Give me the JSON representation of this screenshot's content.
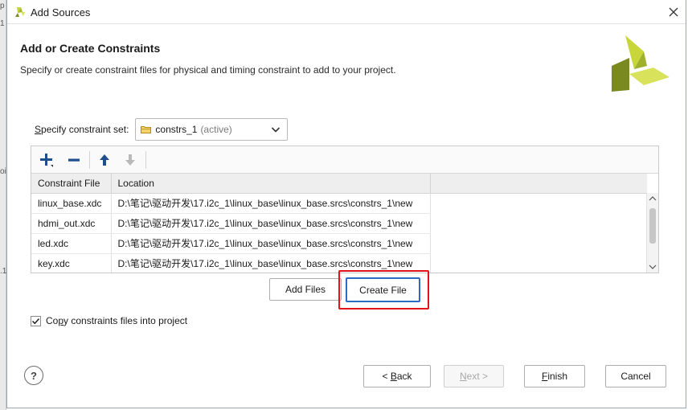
{
  "left_strip": {
    "fragments": [
      "p",
      "1",
      "oi",
      ".1"
    ]
  },
  "window": {
    "title": "Add Sources",
    "close_icon": "close-icon"
  },
  "header": {
    "title": "Add or Create Constraints",
    "subtitle": "Specify or create constraint files for physical and timing constraint to add to your project."
  },
  "constraint_set": {
    "label_prefix": "S",
    "label_rest": "pecify constraint set:",
    "value": "constrs_1",
    "status": "(active)"
  },
  "toolbar": {
    "add_icon": "plus-icon",
    "remove_icon": "minus-icon",
    "up_icon": "arrow-up-icon",
    "down_icon": "arrow-down-icon"
  },
  "table": {
    "headers": [
      "Constraint File",
      "Location"
    ],
    "rows": [
      {
        "file": "linux_base.xdc",
        "location": "D:\\笔记\\驱动开发\\17.i2c_1\\linux_base\\linux_base.srcs\\constrs_1\\new"
      },
      {
        "file": "hdmi_out.xdc",
        "location": "D:\\笔记\\驱动开发\\17.i2c_1\\linux_base\\linux_base.srcs\\constrs_1\\new"
      },
      {
        "file": "led.xdc",
        "location": "D:\\笔记\\驱动开发\\17.i2c_1\\linux_base\\linux_base.srcs\\constrs_1\\new"
      },
      {
        "file": "key.xdc",
        "location": "D:\\笔记\\驱动开发\\17.i2c_1\\linux_base\\linux_base.srcs\\constrs_1\\new"
      }
    ]
  },
  "actions": {
    "add_files": "Add Files",
    "create_file": "Create File"
  },
  "copy_option": {
    "checked": true,
    "label_prefix": "Co",
    "label_underlined": "p",
    "label_rest": "y constraints files into project"
  },
  "footer": {
    "help": "?",
    "back_prefix": "< ",
    "back_underlined": "B",
    "back_rest": "ack",
    "next_underlined": "N",
    "next_rest": "ext >",
    "finish_underlined": "F",
    "finish_rest": "inish",
    "cancel": "Cancel"
  },
  "colors": {
    "highlight": "#e3131b",
    "focus": "#2b6cc4",
    "brand_light": "#c8d639",
    "brand_dark": "#7a8a1e"
  }
}
